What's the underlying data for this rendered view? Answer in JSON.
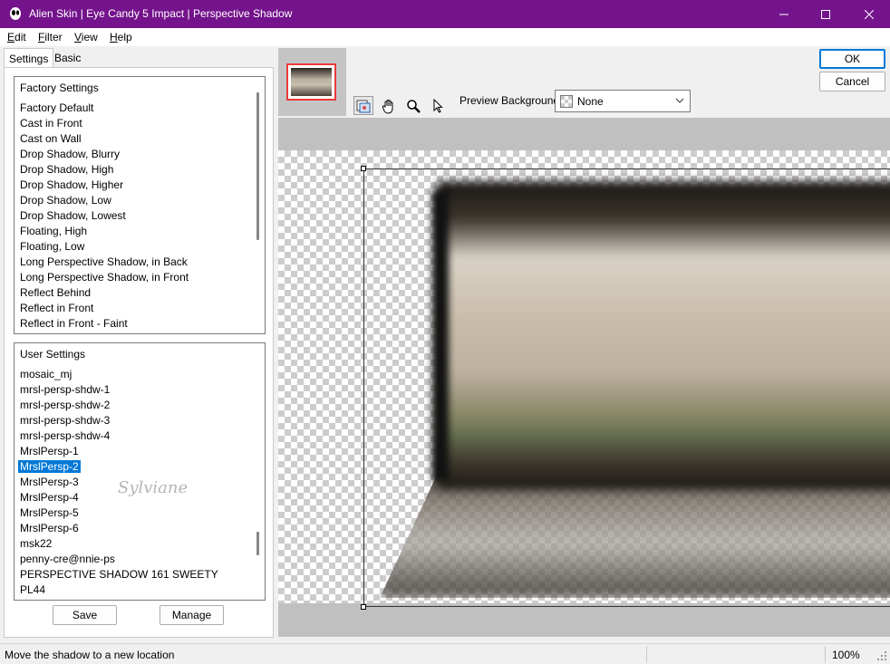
{
  "window": {
    "title": "Alien Skin | Eye Candy 5 Impact | Perspective Shadow",
    "accent_color": "#74138c"
  },
  "menu": {
    "items": [
      {
        "label": "Edit",
        "u": "E",
        "rest": "dit"
      },
      {
        "label": "Filter",
        "u": "F",
        "rest": "ilter"
      },
      {
        "label": "View",
        "u": "V",
        "rest": "iew"
      },
      {
        "label": "Help",
        "u": "H",
        "rest": "elp"
      }
    ]
  },
  "tabs": [
    {
      "label": "Settings",
      "active": true
    },
    {
      "label": "Basic",
      "active": false
    }
  ],
  "factory": {
    "header": "Factory Settings",
    "items": [
      "Factory Default",
      "Cast in Front",
      "Cast on Wall",
      "Drop Shadow, Blurry",
      "Drop Shadow, High",
      "Drop Shadow, Higher",
      "Drop Shadow, Low",
      "Drop Shadow, Lowest",
      "Floating, High",
      "Floating, Low",
      "Long Perspective Shadow, in Back",
      "Long Perspective Shadow, in Front",
      "Reflect Behind",
      "Reflect in Front",
      "Reflect in Front - Faint"
    ]
  },
  "user": {
    "header": "User Settings",
    "selected": "MrslPersp-2",
    "items": [
      "mosaic_mj",
      "mrsl-persp-shdw-1",
      "mrsl-persp-shdw-2",
      "mrsl-persp-shdw-3",
      "mrsl-persp-shdw-4",
      "MrslPersp-1",
      "MrslPersp-2",
      "MrslPersp-3",
      "MrslPersp-4",
      "MrslPersp-5",
      "MrslPersp-6",
      "msk22",
      "penny-cre@nnie-ps",
      "PERSPECTIVE SHADOW 161 SWEETY",
      "PL44"
    ]
  },
  "buttons": {
    "save": "Save",
    "manage": "Manage",
    "ok": "OK",
    "cancel": "Cancel"
  },
  "toolbar": {
    "icons": [
      "preview-toggle-icon",
      "hand-icon",
      "zoom-icon",
      "pointer-icon"
    ]
  },
  "preview_background": {
    "label": "Preview Background:",
    "value": "None"
  },
  "watermark": "Sylviane",
  "status": {
    "message": "Move the shadow to a new location",
    "zoom": "100%"
  }
}
